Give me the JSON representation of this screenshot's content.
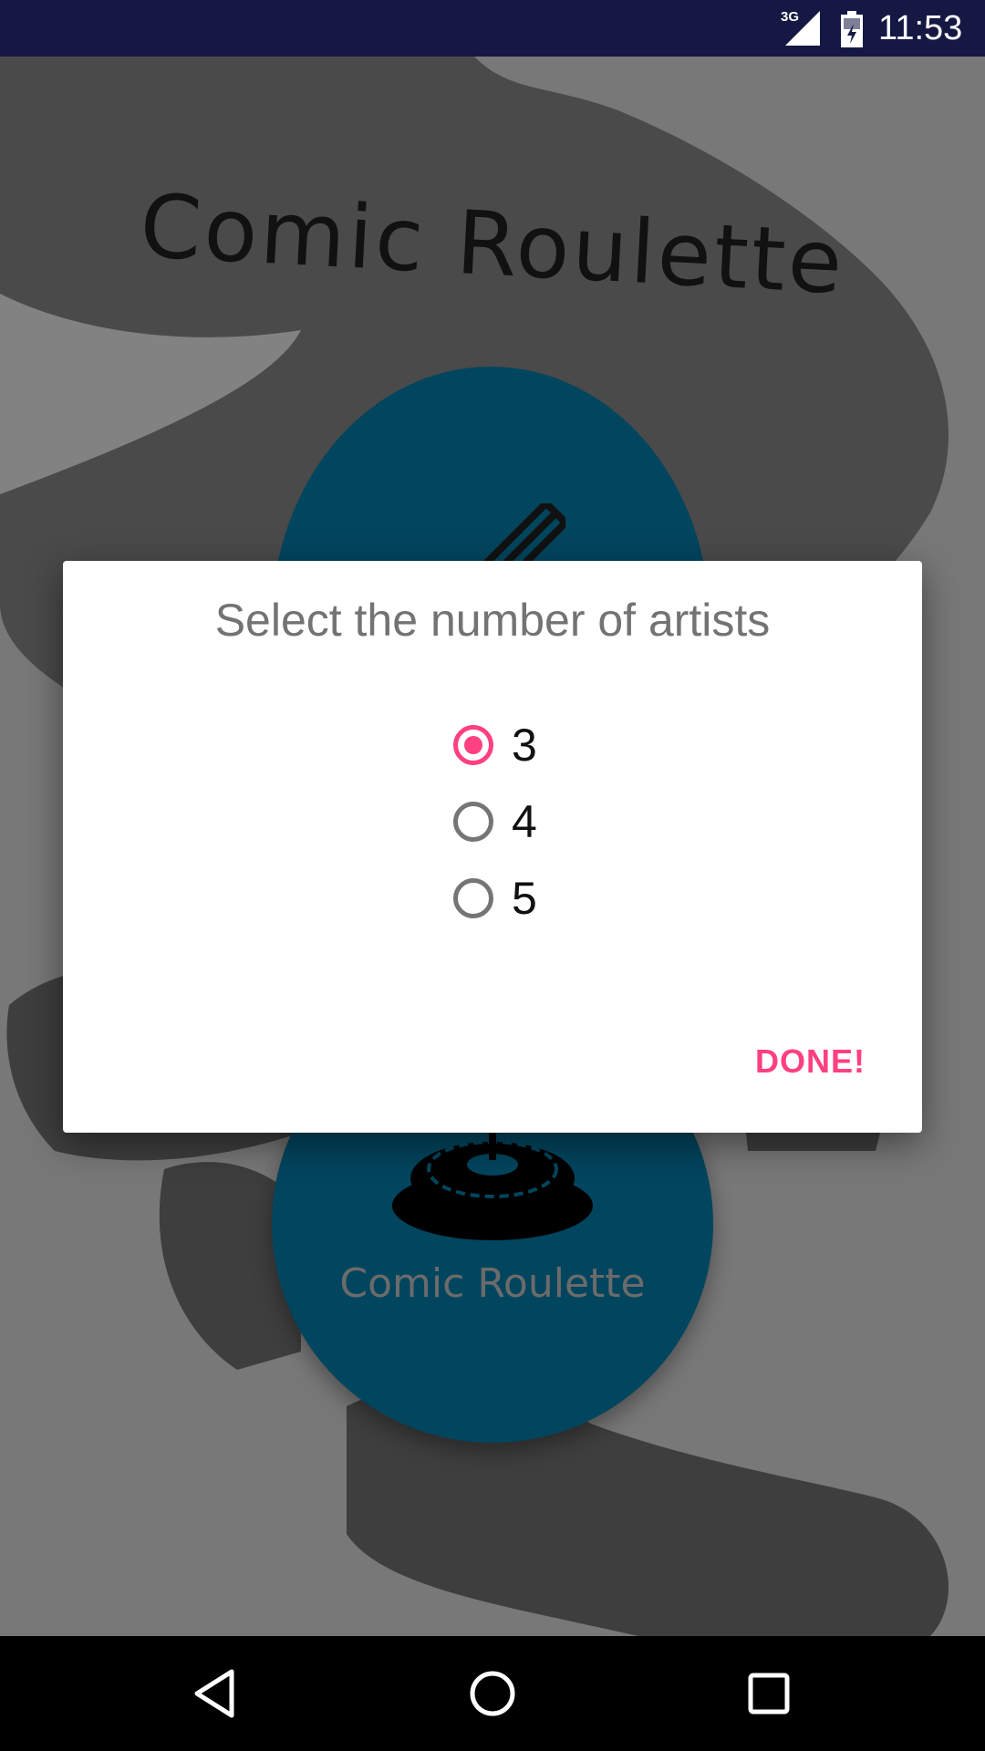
{
  "status_bar": {
    "network": "3G",
    "time": "11:53"
  },
  "app": {
    "title": "Comic Roulette",
    "button_label": "Comic Roulette"
  },
  "dialog": {
    "title": "Select the number of artists",
    "options": [
      {
        "label": "3",
        "selected": true
      },
      {
        "label": "4",
        "selected": false
      },
      {
        "label": "5",
        "selected": false
      }
    ],
    "done_label": "DONE!"
  },
  "nav": {
    "back_icon": "back-triangle-icon",
    "home_icon": "home-circle-icon",
    "recents_icon": "recents-square-icon"
  },
  "colors": {
    "accent": "#ff4081",
    "status_bar": "#141843",
    "circle": "#02455e"
  }
}
